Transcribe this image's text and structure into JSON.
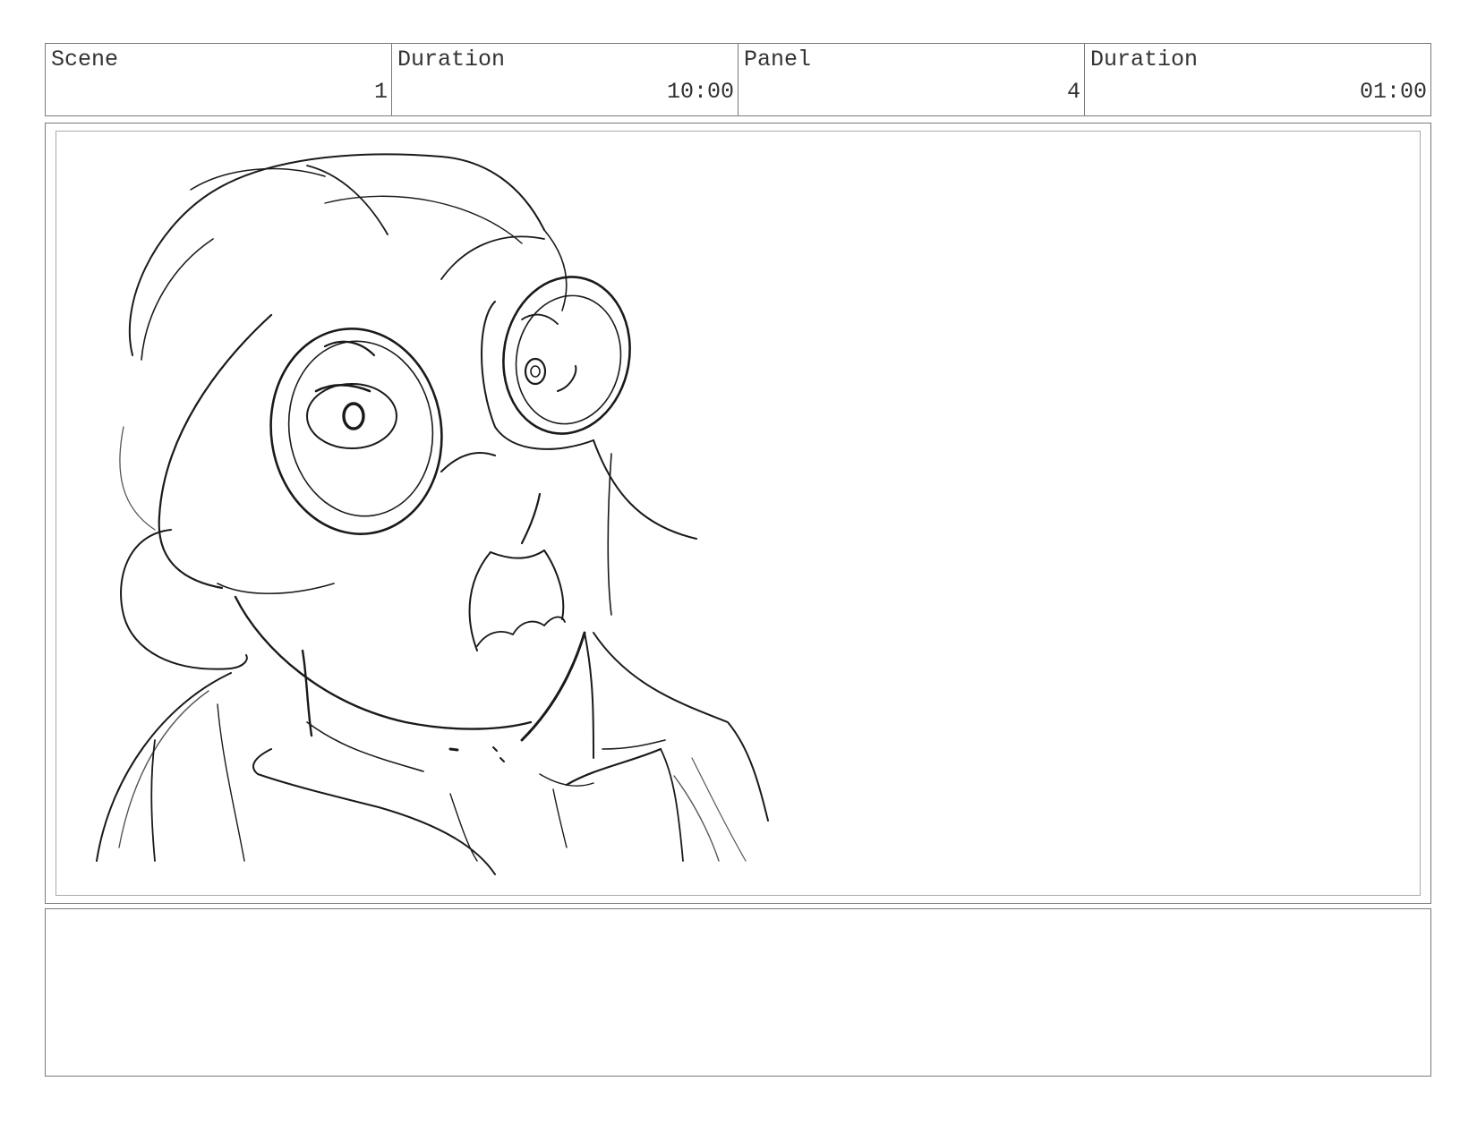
{
  "header": {
    "scene": {
      "label": "Scene",
      "value": "1"
    },
    "scene_duration": {
      "label": "Duration",
      "value": "10:00"
    },
    "panel": {
      "label": "Panel",
      "value": "4"
    },
    "panel_duration": {
      "label": "Duration",
      "value": "01:00"
    }
  },
  "notes": {
    "text": ""
  }
}
